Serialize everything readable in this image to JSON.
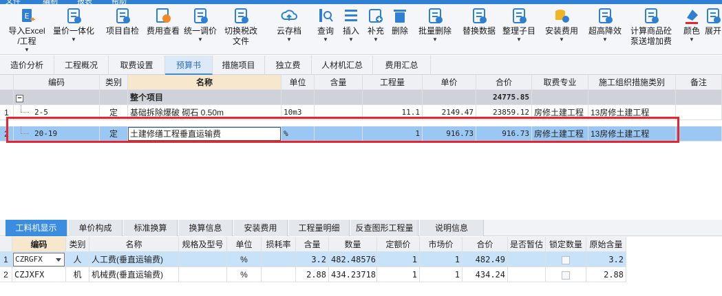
{
  "menubar": [
    "文件",
    "编制",
    "报表",
    "帮助"
  ],
  "ribbon": [
    {
      "label": "导入Excel\n/工程",
      "icon": "excel-import-icon",
      "color": "#2f7fd2",
      "dropdown": true
    },
    {
      "label": "量价一体化",
      "icon": "price-integration-icon",
      "color": "#2f7fd2",
      "dropdown": true
    },
    {
      "label": "项目自检",
      "icon": "self-check-icon",
      "color": "#2f7fd2"
    },
    {
      "label": "费用查看",
      "icon": "fee-view-icon",
      "color": "#f08a24"
    },
    {
      "label": "统一调价",
      "icon": "price-adjust-icon",
      "color": "#2f7fd2",
      "dropdown": true
    },
    {
      "label": "切换税改\n文件",
      "icon": "tax-switch-icon",
      "color": "#2f7fd2"
    },
    {
      "label": "云存档",
      "icon": "cloud-save-icon",
      "color": "#2f7fd2",
      "dropdown": true
    },
    {
      "label": "查询",
      "icon": "query-icon",
      "color": "#2f7fd2",
      "dropdown": true
    },
    {
      "label": "插入",
      "icon": "insert-icon",
      "color": "#2f7fd2",
      "dropdown": true
    },
    {
      "label": "补充",
      "icon": "supplement-icon",
      "color": "#2f7fd2",
      "dropdown": true
    },
    {
      "label": "删除",
      "icon": "delete-icon",
      "color": "#2f7fd2"
    },
    {
      "label": "批量删除",
      "icon": "batch-delete-icon",
      "color": "#2f7fd2",
      "dropdown": true
    },
    {
      "label": "替换数据",
      "icon": "replace-data-icon",
      "color": "#2f7fd2"
    },
    {
      "label": "整理子目",
      "icon": "organize-items-icon",
      "color": "#2f7fd2",
      "dropdown": true
    },
    {
      "label": "安装费用",
      "icon": "install-fee-icon",
      "color": "#f0b424",
      "dropdown": true
    },
    {
      "label": "超高降效",
      "icon": "high-rise-icon",
      "color": "#2f7fd2",
      "dropdown": true
    },
    {
      "label": "计算商品砼\n泵送增加费",
      "icon": "concrete-pump-icon",
      "color": "#2f7fd2"
    },
    {
      "label": "颜色",
      "icon": "color-icon",
      "color": "#2f7fd2",
      "dropdown": true
    },
    {
      "label": "展开",
      "icon": "expand-icon",
      "color": "#2f7fd2"
    }
  ],
  "tabs": [
    "造价分析",
    "工程概况",
    "取费设置",
    "预算书",
    "措施项目",
    "独立费",
    "人材机汇总",
    "费用汇总"
  ],
  "active_tab": "预算书",
  "grid": {
    "headers": [
      "编码",
      "类别",
      "名称",
      "单位",
      "含量",
      "工程量",
      "单价",
      "合价",
      "取费专业",
      "施工组织措施类别",
      "备注"
    ],
    "group": {
      "name": "整个项目",
      "total": "24775.85"
    },
    "rows": [
      {
        "no": "1",
        "code": "2-5",
        "type": "定",
        "name": "基础拆除爆破 砌石 0.50m",
        "unit": "10m3",
        "content": "",
        "qty": "11.1",
        "price": "2149.47",
        "total": "23859.12",
        "major": "房修土建工程",
        "measure": "13房修土建工程",
        "note": ""
      },
      {
        "no": "2",
        "code": "20-19",
        "type": "定",
        "name": "土建修缮工程垂直运输费",
        "unit": "%",
        "content": "",
        "qty": "1",
        "price": "916.73",
        "total": "916.73",
        "major": "房修土建工程",
        "measure": "13房修土建工程",
        "note": ""
      }
    ]
  },
  "bottom_tabs": [
    "工料机显示",
    "单价构成",
    "标准换算",
    "换算信息",
    "安装费用",
    "工程量明细",
    "反查图形工程量",
    "说明信息"
  ],
  "bottom_active": "工料机显示",
  "bottom_grid": {
    "headers": [
      "编码",
      "类别",
      "名称",
      "规格及型号",
      "单位",
      "损耗率",
      "含量",
      "数量",
      "定额价",
      "市场价",
      "合价",
      "是否暂估",
      "锁定数量",
      "原始含量"
    ],
    "rows": [
      {
        "no": "1",
        "code": "CZRGFX",
        "type": "人",
        "name": "人工费(垂直运输费)",
        "spec": "",
        "unit": "%",
        "loss": "",
        "content": "3.2",
        "qty": "482.48576",
        "base": "1",
        "market": "1",
        "total": "482.49",
        "est": "",
        "orig": "3.2"
      },
      {
        "no": "2",
        "code": "CZJXFX",
        "type": "机",
        "name": "机械费(垂直运输费)",
        "spec": "",
        "unit": "%",
        "loss": "",
        "content": "2.88",
        "qty": "434.23718",
        "base": "1",
        "market": "1",
        "total": "434.24",
        "est": "",
        "orig": "2.88"
      }
    ]
  },
  "colors": {
    "accent": "#3b8de0",
    "highlight_border": "#e8242f",
    "selected_row": "#9bc8f2",
    "group_row": "#cfd3d9"
  }
}
